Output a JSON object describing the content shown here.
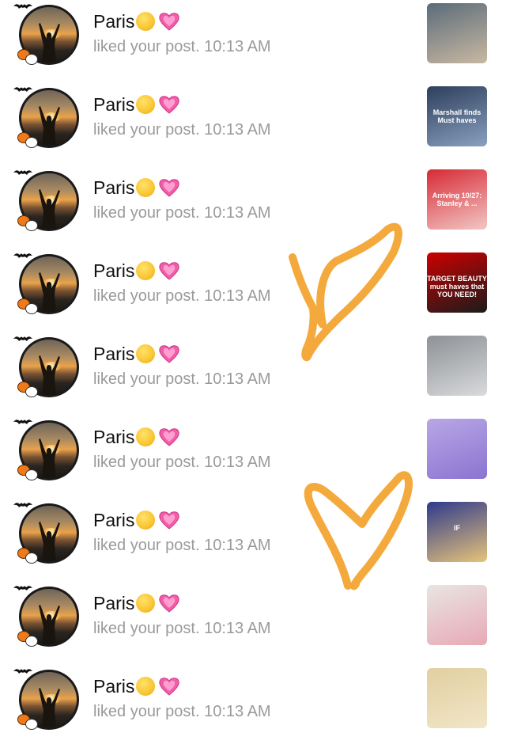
{
  "notifications": [
    {
      "user": "Paris",
      "message": "liked your post.",
      "time": "10:13 AM",
      "thumb": {
        "colors": [
          "#5a6c7a",
          "#c9b8a2"
        ],
        "caption": ""
      }
    },
    {
      "user": "Paris",
      "message": "liked your post.",
      "time": "10:13 AM",
      "thumb": {
        "colors": [
          "#2c3f5c",
          "#8aa0bf"
        ],
        "caption": "Marshall finds\nMust haves"
      }
    },
    {
      "user": "Paris",
      "message": "liked your post.",
      "time": "10:13 AM",
      "thumb": {
        "colors": [
          "#d72a35",
          "#f2c7c5"
        ],
        "caption": "Arriving 10/27: Stanley & ..."
      }
    },
    {
      "user": "Paris",
      "message": "liked your post.",
      "time": "10:13 AM",
      "thumb": {
        "colors": [
          "#cc0000",
          "#1b1b1b"
        ],
        "caption": "TARGET BEAUTY must haves that YOU NEED!"
      }
    },
    {
      "user": "Paris",
      "message": "liked your post.",
      "time": "10:13 AM",
      "thumb": {
        "colors": [
          "#8e9195",
          "#d8dadc"
        ],
        "caption": ""
      }
    },
    {
      "user": "Paris",
      "message": "liked your post.",
      "time": "10:13 AM",
      "thumb": {
        "colors": [
          "#b8a7e6",
          "#8a74d1"
        ],
        "caption": ""
      }
    },
    {
      "user": "Paris",
      "message": "liked your post.",
      "time": "10:13 AM",
      "thumb": {
        "colors": [
          "#2e3a8c",
          "#e6c37a"
        ],
        "caption": "IF"
      }
    },
    {
      "user": "Paris",
      "message": "liked your post.",
      "time": "10:13 AM",
      "thumb": {
        "colors": [
          "#e9e5e2",
          "#e7a9b6"
        ],
        "caption": ""
      }
    },
    {
      "user": "Paris",
      "message": "liked your post.",
      "time": "10:13 AM",
      "thumb": {
        "colors": [
          "#e2cfa0",
          "#f1e6c8"
        ],
        "caption": ""
      }
    }
  ],
  "icons": {
    "smile": "smiling-face-icon",
    "heart": "sparkling-heart-icon"
  },
  "colors": {
    "name": "#111111",
    "meta": "#9a9a9a",
    "scribble": "#f4a93d",
    "heart": "#f25ca8"
  }
}
